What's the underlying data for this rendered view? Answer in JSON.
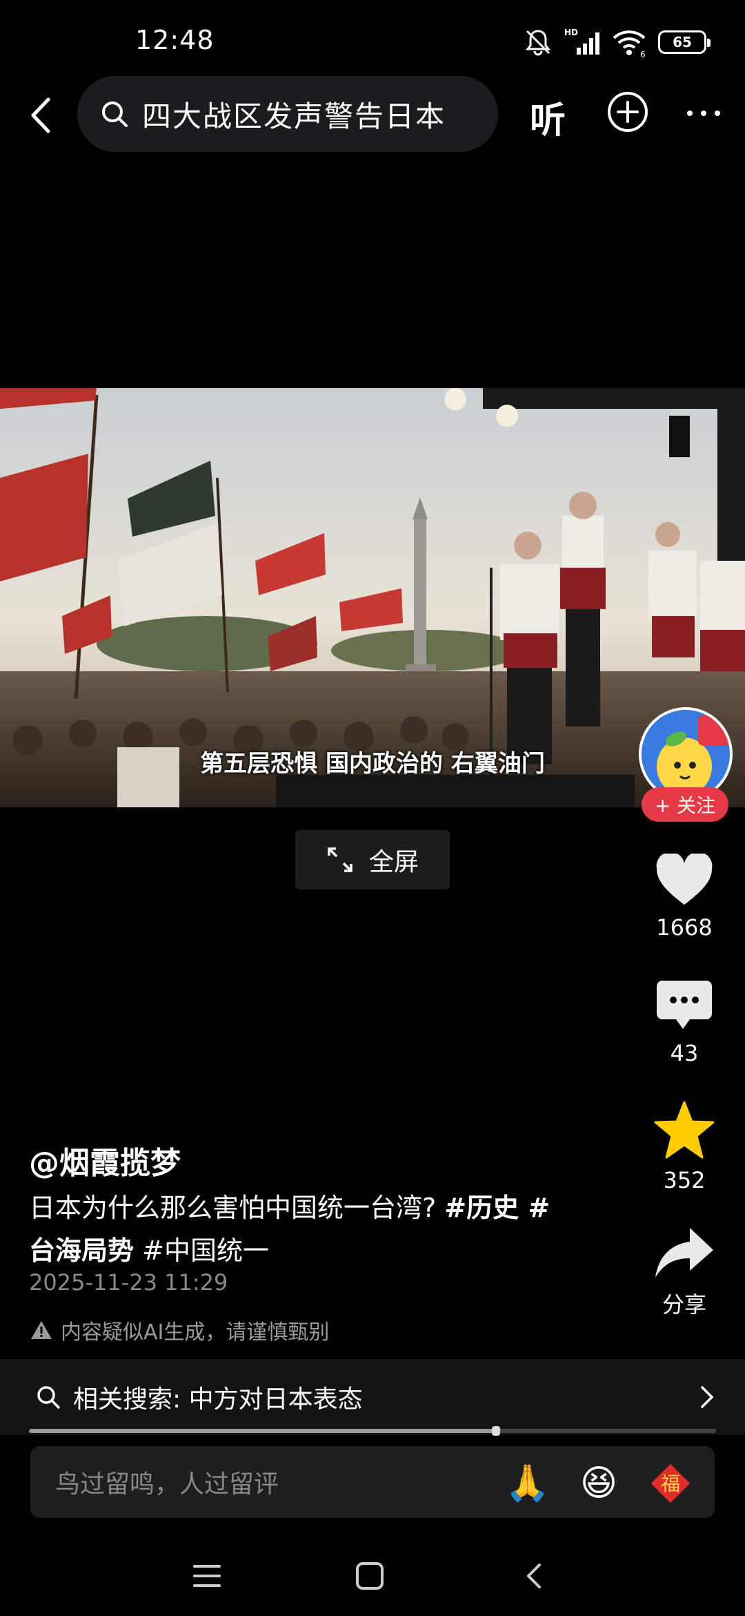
{
  "status_bar": {
    "time": "12:48",
    "battery": "65"
  },
  "top_nav": {
    "search_query": "四大战区发声警告日本",
    "listen_label": "听"
  },
  "video": {
    "subtitle": "第五层恐惧 国内政治的 右翼油门"
  },
  "fullscreen_label": "全屏",
  "right_rail": {
    "follow_label": "+ 关注",
    "likes": "1668",
    "comments": "43",
    "favorites": "352",
    "share_label": "分享"
  },
  "post": {
    "username": "@烟霞揽梦",
    "caption_text": "日本为什么那么害怕中国统一台湾? ",
    "tag1": "#历史 #",
    "tag2": "台海局势",
    "tag3": "#中国统一",
    "date": "2025-11-23 11:29",
    "ai_notice": "内容疑似AI生成，请谨慎甄别"
  },
  "related_search": {
    "label": "相关搜索: 中方对日本表态"
  },
  "playback": {
    "progress": 0.68
  },
  "comment_input": {
    "placeholder": "鸟过留鸣，人过留评"
  },
  "emoji_shortcuts": [
    "🙏",
    "😆",
    "福"
  ]
}
